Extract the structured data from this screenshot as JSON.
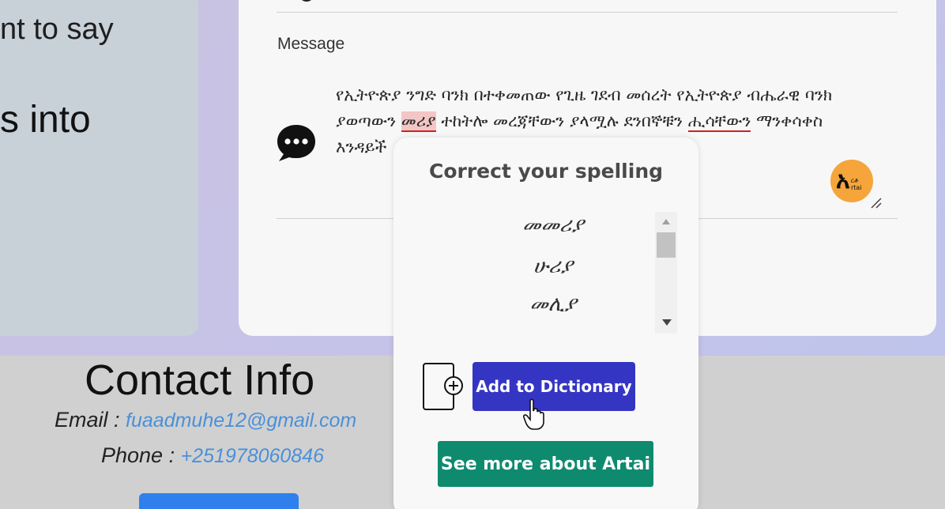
{
  "left_panel": {
    "line1": "nt to say",
    "line2": "s into"
  },
  "form": {
    "message_label": "Message",
    "message_text_parts": {
      "p1": "የኢትዮጵያ ንግድ ባንክ በተቀመጠው የጊዜ ገደብ መሰረት የኢትዮጵያ ብሔራዊ ባንክ ያወጣውን ",
      "err1": "መሪያ",
      "p2": " ተከትሎ መረጃቸውን ያላሟሉ ደንበኞቹን  ",
      "err2": "ሒሳቸውን",
      "p3": " ማንቀሳቀስ እንዳይች"
    },
    "badge": {
      "glyph": "አ",
      "mini1": "ርቶ",
      "mini2": "rtai"
    }
  },
  "spell_popup": {
    "title": "Correct your spelling",
    "suggestions": [
      "መመሪያ",
      "ሁሪያ",
      "መሊያ"
    ],
    "add_button": "Add to Dictionary",
    "see_more_button": "See more about Artai"
  },
  "contact": {
    "title": "Contact Info",
    "email_label": "Email : ",
    "email": "fuaadmuhe12@gmail.com",
    "phone_label": "Phone : ",
    "phone": "+251978060846"
  },
  "colors": {
    "popup_primary": "#3535c4",
    "popup_secondary": "#0e8a6f",
    "error_underline": "#cc2222",
    "link": "#4a90d9",
    "badge": "#f5a53a"
  }
}
